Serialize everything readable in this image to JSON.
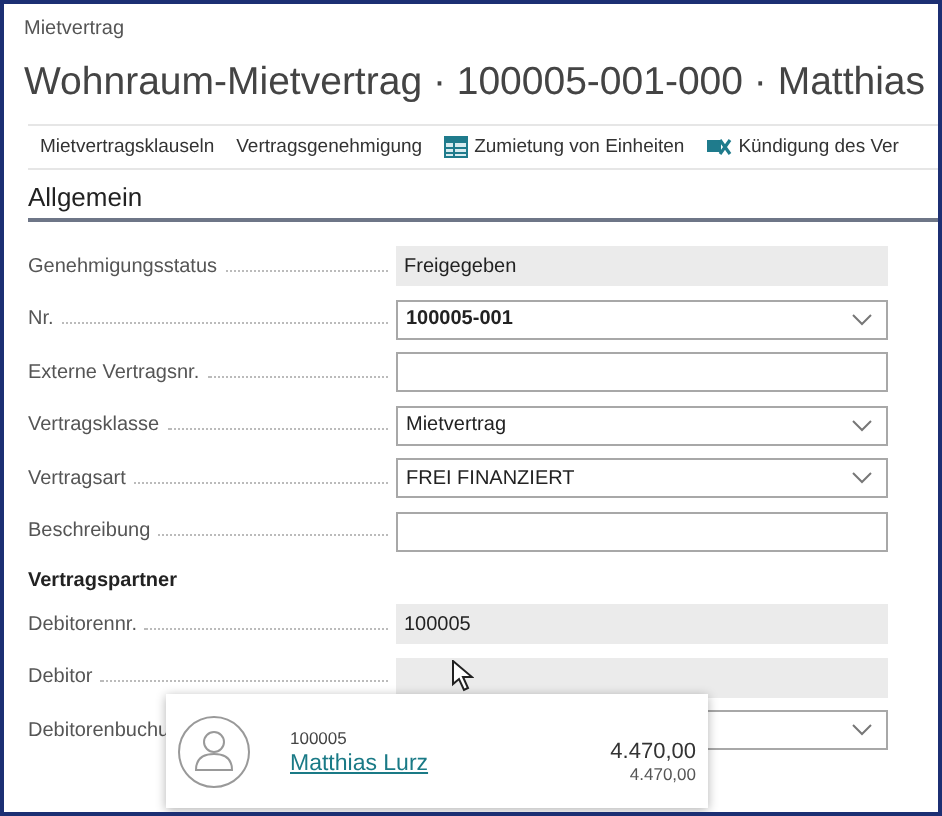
{
  "breadcrumb": "Mietvertrag",
  "title": "Wohnraum-Mietvertrag · 100005-001-000 · Matthias",
  "actions": [
    {
      "label": "Mietvertragsklauseln"
    },
    {
      "label": "Vertragsgenehmigung"
    },
    {
      "label": "Zumietung von Einheiten"
    },
    {
      "label": "Kündigung des Ver"
    }
  ],
  "section": {
    "title": "Allgemein"
  },
  "fields": [
    {
      "kind": "readonly",
      "label": "Genehmigungsstatus",
      "value": "Freigegeben"
    },
    {
      "kind": "dropdown",
      "label": "Nr.",
      "value": "100005-001",
      "bold": true
    },
    {
      "kind": "input",
      "label": "Externe Vertragsnr."
    },
    {
      "kind": "dropdown",
      "label": "Vertragsklasse",
      "value": "Mietvertrag"
    },
    {
      "kind": "dropdown",
      "label": "Vertragsart",
      "value": "FREI FINANZIERT"
    },
    {
      "kind": "input",
      "label": "Beschreibung"
    },
    {
      "kind": "group",
      "label": "Vertragspartner"
    },
    {
      "kind": "readonly",
      "label": "Debitorennr.",
      "value": "100005"
    },
    {
      "kind": "readonly",
      "label": "Debitor"
    },
    {
      "kind": "dropdown",
      "label": "Debitorenbuchu"
    }
  ],
  "popup": {
    "number": "100005",
    "name": "Matthias Lurz",
    "amount": "4.470,00",
    "subamount": "4.470,00"
  }
}
